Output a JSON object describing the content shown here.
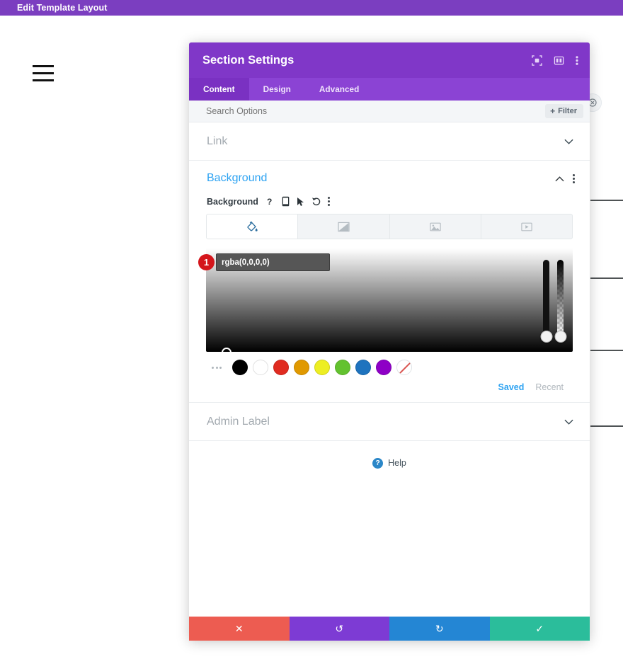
{
  "admin_bar": {
    "title": "Edit Template Layout"
  },
  "page": {
    "menu_icon": "hamburger-icon",
    "close_icon": "close-circle-icon",
    "divider_tops": [
      282,
      392,
      494,
      601
    ]
  },
  "modal": {
    "title": "Section Settings",
    "header_icons": [
      {
        "name": "focus-target-icon"
      },
      {
        "name": "split-layout-icon"
      },
      {
        "name": "kebab-menu-icon"
      }
    ],
    "tabs": [
      {
        "label": "Content",
        "active": true
      },
      {
        "label": "Design",
        "active": false
      },
      {
        "label": "Advanced",
        "active": false
      }
    ],
    "search": {
      "placeholder": "Search Options",
      "value": ""
    },
    "filter_button": {
      "label": "Filter",
      "plus": "+"
    },
    "sections": [
      {
        "name": "link",
        "title": "Link",
        "state": "collapsed",
        "chevron": "⌄"
      },
      {
        "name": "background",
        "title": "Background",
        "state": "expanded",
        "chevron": "⌃"
      },
      {
        "name": "admin-label",
        "title": "Admin Label",
        "state": "collapsed",
        "chevron": "⌄"
      }
    ],
    "background": {
      "field_label": "Background",
      "field_icons": [
        {
          "name": "help-question-icon",
          "glyph": "?"
        },
        {
          "name": "responsive-mobile-icon"
        },
        {
          "name": "hover-cursor-icon"
        },
        {
          "name": "reset-undo-icon"
        },
        {
          "name": "options-kebab-icon"
        }
      ],
      "type_tabs": [
        {
          "name": "background-color-tab",
          "icon": "paint-bucket-icon",
          "active": true
        },
        {
          "name": "background-gradient-tab",
          "icon": "gradient-icon",
          "active": false
        },
        {
          "name": "background-image-tab",
          "icon": "image-icon",
          "active": false
        },
        {
          "name": "background-video-tab",
          "icon": "video-icon",
          "active": false
        }
      ],
      "color_value": "rgba(0,0,0,0)",
      "confirm_glyph": "✓",
      "step_badge": "1",
      "swatches": [
        {
          "name": "swatch-black",
          "hex": "#000000"
        },
        {
          "name": "swatch-white",
          "hex": "#ffffff"
        },
        {
          "name": "swatch-red",
          "hex": "#e02b20"
        },
        {
          "name": "swatch-orange",
          "hex": "#e09900"
        },
        {
          "name": "swatch-yellow",
          "hex": "#edee23"
        },
        {
          "name": "swatch-green",
          "hex": "#63c22f"
        },
        {
          "name": "swatch-blue",
          "hex": "#1e73be"
        },
        {
          "name": "swatch-purple",
          "hex": "#8e00c6"
        },
        {
          "name": "swatch-none",
          "hex": "transparent"
        }
      ],
      "palette_tabs": [
        {
          "label": "Saved",
          "active": true
        },
        {
          "label": "Recent",
          "active": false
        }
      ]
    },
    "help": {
      "label": "Help",
      "glyph": "?"
    },
    "footer_buttons": [
      {
        "name": "cancel-button",
        "glyph": "✕",
        "color": "#ed5c51"
      },
      {
        "name": "undo-button",
        "glyph": "↺",
        "color": "#7d3bd4"
      },
      {
        "name": "redo-button",
        "glyph": "↻",
        "color": "#2486d4"
      },
      {
        "name": "save-button",
        "glyph": "✓",
        "color": "#2bbd9b"
      }
    ]
  }
}
